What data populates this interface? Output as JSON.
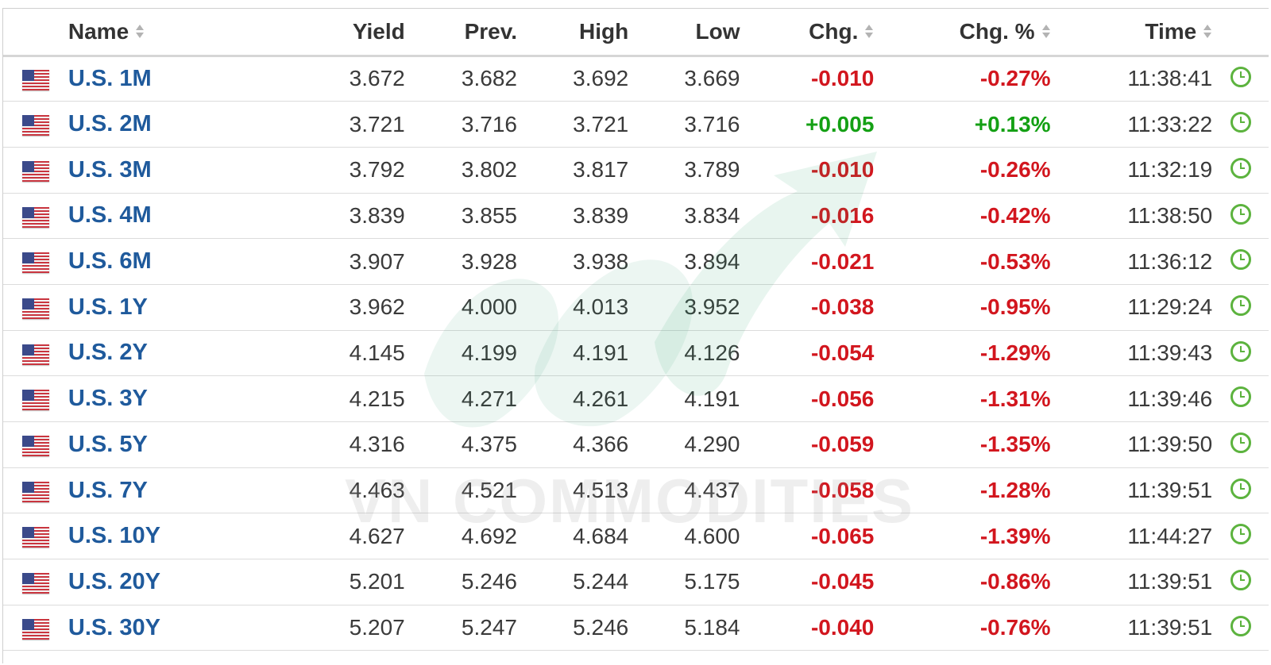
{
  "header": {
    "name": "Name",
    "yield": "Yield",
    "prev": "Prev.",
    "high": "High",
    "low": "Low",
    "chg": "Chg.",
    "chg_pct": "Chg. %",
    "time": "Time"
  },
  "watermark": "VN COMMODITIES",
  "colors": {
    "name_link": "#1f5a9c",
    "negative": "#d2161e",
    "positive": "#14a014",
    "clock": "#5cb33e"
  },
  "rows": [
    {
      "name": "U.S. 1M",
      "yield": "3.672",
      "prev": "3.682",
      "high": "3.692",
      "low": "3.669",
      "chg": "-0.010",
      "chg_pct": "-0.27%",
      "time": "11:38:41",
      "direction": "neg"
    },
    {
      "name": "U.S. 2M",
      "yield": "3.721",
      "prev": "3.716",
      "high": "3.721",
      "low": "3.716",
      "chg": "+0.005",
      "chg_pct": "+0.13%",
      "time": "11:33:22",
      "direction": "pos"
    },
    {
      "name": "U.S. 3M",
      "yield": "3.792",
      "prev": "3.802",
      "high": "3.817",
      "low": "3.789",
      "chg": "-0.010",
      "chg_pct": "-0.26%",
      "time": "11:32:19",
      "direction": "neg"
    },
    {
      "name": "U.S. 4M",
      "yield": "3.839",
      "prev": "3.855",
      "high": "3.839",
      "low": "3.834",
      "chg": "-0.016",
      "chg_pct": "-0.42%",
      "time": "11:38:50",
      "direction": "neg"
    },
    {
      "name": "U.S. 6M",
      "yield": "3.907",
      "prev": "3.928",
      "high": "3.938",
      "low": "3.894",
      "chg": "-0.021",
      "chg_pct": "-0.53%",
      "time": "11:36:12",
      "direction": "neg"
    },
    {
      "name": "U.S. 1Y",
      "yield": "3.962",
      "prev": "4.000",
      "high": "4.013",
      "low": "3.952",
      "chg": "-0.038",
      "chg_pct": "-0.95%",
      "time": "11:29:24",
      "direction": "neg"
    },
    {
      "name": "U.S. 2Y",
      "yield": "4.145",
      "prev": "4.199",
      "high": "4.191",
      "low": "4.126",
      "chg": "-0.054",
      "chg_pct": "-1.29%",
      "time": "11:39:43",
      "direction": "neg"
    },
    {
      "name": "U.S. 3Y",
      "yield": "4.215",
      "prev": "4.271",
      "high": "4.261",
      "low": "4.191",
      "chg": "-0.056",
      "chg_pct": "-1.31%",
      "time": "11:39:46",
      "direction": "neg"
    },
    {
      "name": "U.S. 5Y",
      "yield": "4.316",
      "prev": "4.375",
      "high": "4.366",
      "low": "4.290",
      "chg": "-0.059",
      "chg_pct": "-1.35%",
      "time": "11:39:50",
      "direction": "neg"
    },
    {
      "name": "U.S. 7Y",
      "yield": "4.463",
      "prev": "4.521",
      "high": "4.513",
      "low": "4.437",
      "chg": "-0.058",
      "chg_pct": "-1.28%",
      "time": "11:39:51",
      "direction": "neg"
    },
    {
      "name": "U.S. 10Y",
      "yield": "4.627",
      "prev": "4.692",
      "high": "4.684",
      "low": "4.600",
      "chg": "-0.065",
      "chg_pct": "-1.39%",
      "time": "11:44:27",
      "direction": "neg"
    },
    {
      "name": "U.S. 20Y",
      "yield": "5.201",
      "prev": "5.246",
      "high": "5.244",
      "low": "5.175",
      "chg": "-0.045",
      "chg_pct": "-0.86%",
      "time": "11:39:51",
      "direction": "neg"
    },
    {
      "name": "U.S. 30Y",
      "yield": "5.207",
      "prev": "5.247",
      "high": "5.246",
      "low": "5.184",
      "chg": "-0.040",
      "chg_pct": "-0.76%",
      "time": "11:39:51",
      "direction": "neg"
    }
  ]
}
